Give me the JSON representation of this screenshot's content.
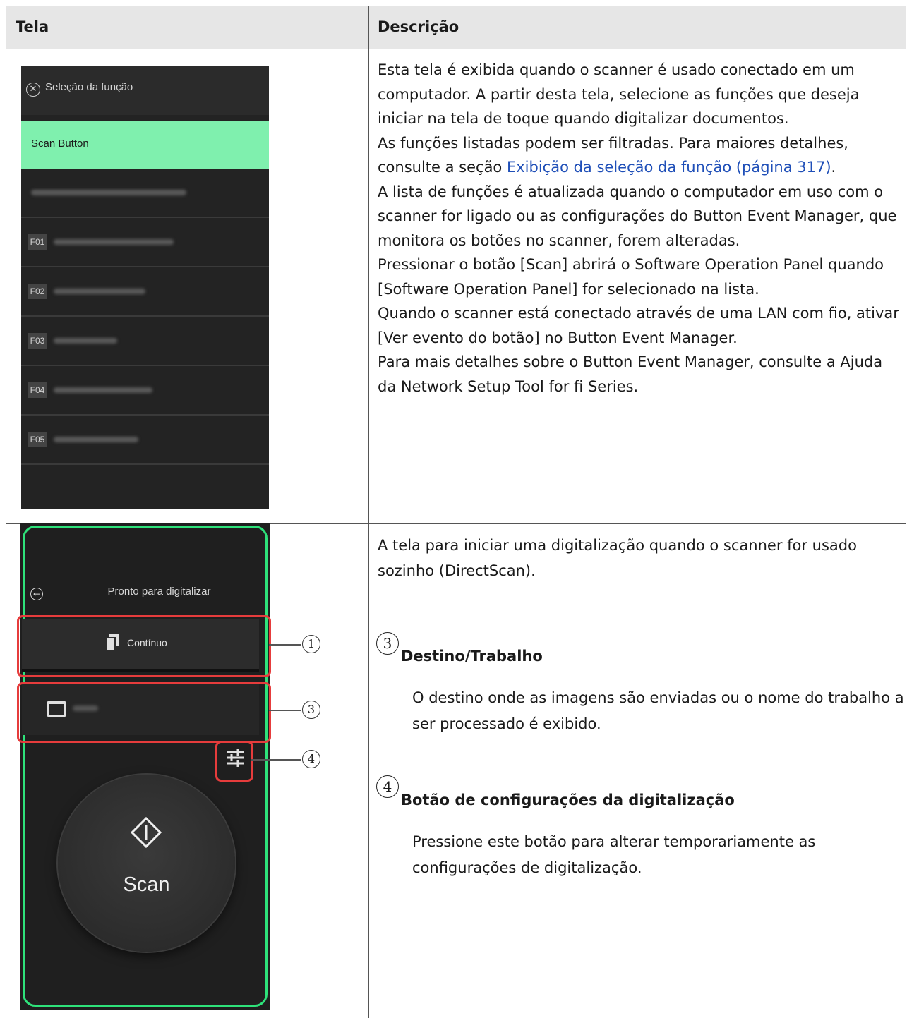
{
  "header": {
    "col1": "Tela",
    "col2": "Descrição"
  },
  "row1": {
    "screen": {
      "title": "Seleção da função",
      "selected": "Scan Button",
      "items": [
        "F01",
        "F02",
        "F03",
        "F04",
        "F05"
      ]
    },
    "desc": {
      "p1": "Esta tela é exibida quando o scanner é usado conectado em um computador. A partir desta tela, selecione as funções que deseja iniciar na tela de toque quando digitalizar documentos.",
      "p2_pre": "As funções listadas podem ser filtradas. Para maiores detalhes, consulte a seção ",
      "p2_link": "Exibição da seleção da função (página 317)",
      "p2_post": ".",
      "p3": "A lista de funções é atualizada quando o computador em uso com o scanner for ligado ou as configurações do Button Event Manager, que monitora os botões no scanner, forem alteradas.",
      "p4": "Pressionar o botão [Scan] abrirá o Software Operation Panel quando [Software Operation Panel] for selecionado na lista.",
      "p5": "Quando o scanner está conectado através de uma LAN com fio, ativar [Ver evento do botão] no Button Event Manager.",
      "p6": "Para mais detalhes sobre o Button Event Manager, consulte a Ajuda da Network Setup Tool for fi Series."
    }
  },
  "row2": {
    "screen": {
      "title": "Pronto para digitalizar",
      "continuous": "Contínuo",
      "scan": "Scan",
      "callouts": [
        "1",
        "3",
        "4"
      ]
    },
    "desc": {
      "intro": "A tela para iniciar uma digitalização quando o scanner for usado sozinho (DirectScan).",
      "s3_num": "3",
      "s3_title": "Destino/Trabalho",
      "s3_text": "O destino onde as imagens são enviadas ou o nome do trabalho a ser processado é exibido.",
      "s4_num": "4",
      "s4_title": "Botão de configurações da digitalização",
      "s4_text": "Pressione este botão para alterar temporariamente as configurações de digitalização."
    }
  },
  "colors": {
    "accent_green": "#2ee27a",
    "selection_green": "#7ff0ae",
    "callout_red": "#e63c3c",
    "link": "#1f4fb8"
  }
}
